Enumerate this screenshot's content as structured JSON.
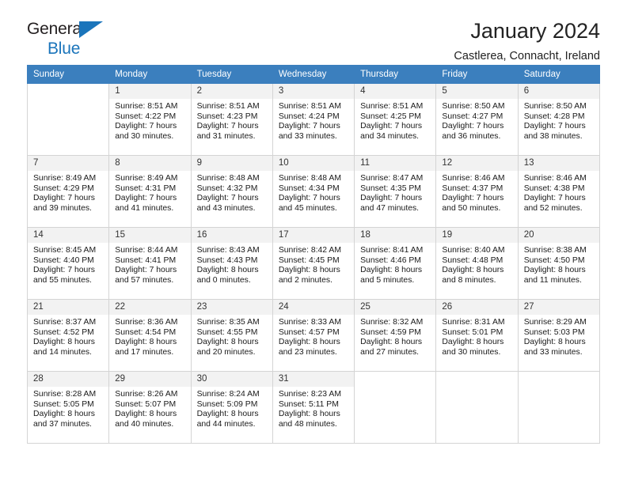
{
  "brand": {
    "line1": "General",
    "line2": "Blue",
    "triangle_color": "#1b75bb"
  },
  "header": {
    "title": "January 2024",
    "subtitle": "Castlerea, Connacht, Ireland"
  },
  "theme": {
    "header_row_bg": "#3b7fbe",
    "daynum_bg": "#f2f2f2",
    "grid_border": "#d4d4d4"
  },
  "labels": {
    "sunrise_prefix": "Sunrise:",
    "sunset_prefix": "Sunset:",
    "daylight_prefix": "Daylight:"
  },
  "weekdays": [
    "Sunday",
    "Monday",
    "Tuesday",
    "Wednesday",
    "Thursday",
    "Friday",
    "Saturday"
  ],
  "weeks": [
    [
      {
        "empty": true
      },
      {
        "day": "1",
        "sunrise": "Sunrise: 8:51 AM",
        "sunset": "Sunset: 4:22 PM",
        "daylight_l1": "Daylight: 7 hours",
        "daylight_l2": "and 30 minutes."
      },
      {
        "day": "2",
        "sunrise": "Sunrise: 8:51 AM",
        "sunset": "Sunset: 4:23 PM",
        "daylight_l1": "Daylight: 7 hours",
        "daylight_l2": "and 31 minutes."
      },
      {
        "day": "3",
        "sunrise": "Sunrise: 8:51 AM",
        "sunset": "Sunset: 4:24 PM",
        "daylight_l1": "Daylight: 7 hours",
        "daylight_l2": "and 33 minutes."
      },
      {
        "day": "4",
        "sunrise": "Sunrise: 8:51 AM",
        "sunset": "Sunset: 4:25 PM",
        "daylight_l1": "Daylight: 7 hours",
        "daylight_l2": "and 34 minutes."
      },
      {
        "day": "5",
        "sunrise": "Sunrise: 8:50 AM",
        "sunset": "Sunset: 4:27 PM",
        "daylight_l1": "Daylight: 7 hours",
        "daylight_l2": "and 36 minutes."
      },
      {
        "day": "6",
        "sunrise": "Sunrise: 8:50 AM",
        "sunset": "Sunset: 4:28 PM",
        "daylight_l1": "Daylight: 7 hours",
        "daylight_l2": "and 38 minutes."
      }
    ],
    [
      {
        "day": "7",
        "sunrise": "Sunrise: 8:49 AM",
        "sunset": "Sunset: 4:29 PM",
        "daylight_l1": "Daylight: 7 hours",
        "daylight_l2": "and 39 minutes."
      },
      {
        "day": "8",
        "sunrise": "Sunrise: 8:49 AM",
        "sunset": "Sunset: 4:31 PM",
        "daylight_l1": "Daylight: 7 hours",
        "daylight_l2": "and 41 minutes."
      },
      {
        "day": "9",
        "sunrise": "Sunrise: 8:48 AM",
        "sunset": "Sunset: 4:32 PM",
        "daylight_l1": "Daylight: 7 hours",
        "daylight_l2": "and 43 minutes."
      },
      {
        "day": "10",
        "sunrise": "Sunrise: 8:48 AM",
        "sunset": "Sunset: 4:34 PM",
        "daylight_l1": "Daylight: 7 hours",
        "daylight_l2": "and 45 minutes."
      },
      {
        "day": "11",
        "sunrise": "Sunrise: 8:47 AM",
        "sunset": "Sunset: 4:35 PM",
        "daylight_l1": "Daylight: 7 hours",
        "daylight_l2": "and 47 minutes."
      },
      {
        "day": "12",
        "sunrise": "Sunrise: 8:46 AM",
        "sunset": "Sunset: 4:37 PM",
        "daylight_l1": "Daylight: 7 hours",
        "daylight_l2": "and 50 minutes."
      },
      {
        "day": "13",
        "sunrise": "Sunrise: 8:46 AM",
        "sunset": "Sunset: 4:38 PM",
        "daylight_l1": "Daylight: 7 hours",
        "daylight_l2": "and 52 minutes."
      }
    ],
    [
      {
        "day": "14",
        "sunrise": "Sunrise: 8:45 AM",
        "sunset": "Sunset: 4:40 PM",
        "daylight_l1": "Daylight: 7 hours",
        "daylight_l2": "and 55 minutes."
      },
      {
        "day": "15",
        "sunrise": "Sunrise: 8:44 AM",
        "sunset": "Sunset: 4:41 PM",
        "daylight_l1": "Daylight: 7 hours",
        "daylight_l2": "and 57 minutes."
      },
      {
        "day": "16",
        "sunrise": "Sunrise: 8:43 AM",
        "sunset": "Sunset: 4:43 PM",
        "daylight_l1": "Daylight: 8 hours",
        "daylight_l2": "and 0 minutes."
      },
      {
        "day": "17",
        "sunrise": "Sunrise: 8:42 AM",
        "sunset": "Sunset: 4:45 PM",
        "daylight_l1": "Daylight: 8 hours",
        "daylight_l2": "and 2 minutes."
      },
      {
        "day": "18",
        "sunrise": "Sunrise: 8:41 AM",
        "sunset": "Sunset: 4:46 PM",
        "daylight_l1": "Daylight: 8 hours",
        "daylight_l2": "and 5 minutes."
      },
      {
        "day": "19",
        "sunrise": "Sunrise: 8:40 AM",
        "sunset": "Sunset: 4:48 PM",
        "daylight_l1": "Daylight: 8 hours",
        "daylight_l2": "and 8 minutes."
      },
      {
        "day": "20",
        "sunrise": "Sunrise: 8:38 AM",
        "sunset": "Sunset: 4:50 PM",
        "daylight_l1": "Daylight: 8 hours",
        "daylight_l2": "and 11 minutes."
      }
    ],
    [
      {
        "day": "21",
        "sunrise": "Sunrise: 8:37 AM",
        "sunset": "Sunset: 4:52 PM",
        "daylight_l1": "Daylight: 8 hours",
        "daylight_l2": "and 14 minutes."
      },
      {
        "day": "22",
        "sunrise": "Sunrise: 8:36 AM",
        "sunset": "Sunset: 4:54 PM",
        "daylight_l1": "Daylight: 8 hours",
        "daylight_l2": "and 17 minutes."
      },
      {
        "day": "23",
        "sunrise": "Sunrise: 8:35 AM",
        "sunset": "Sunset: 4:55 PM",
        "daylight_l1": "Daylight: 8 hours",
        "daylight_l2": "and 20 minutes."
      },
      {
        "day": "24",
        "sunrise": "Sunrise: 8:33 AM",
        "sunset": "Sunset: 4:57 PM",
        "daylight_l1": "Daylight: 8 hours",
        "daylight_l2": "and 23 minutes."
      },
      {
        "day": "25",
        "sunrise": "Sunrise: 8:32 AM",
        "sunset": "Sunset: 4:59 PM",
        "daylight_l1": "Daylight: 8 hours",
        "daylight_l2": "and 27 minutes."
      },
      {
        "day": "26",
        "sunrise": "Sunrise: 8:31 AM",
        "sunset": "Sunset: 5:01 PM",
        "daylight_l1": "Daylight: 8 hours",
        "daylight_l2": "and 30 minutes."
      },
      {
        "day": "27",
        "sunrise": "Sunrise: 8:29 AM",
        "sunset": "Sunset: 5:03 PM",
        "daylight_l1": "Daylight: 8 hours",
        "daylight_l2": "and 33 minutes."
      }
    ],
    [
      {
        "day": "28",
        "sunrise": "Sunrise: 8:28 AM",
        "sunset": "Sunset: 5:05 PM",
        "daylight_l1": "Daylight: 8 hours",
        "daylight_l2": "and 37 minutes."
      },
      {
        "day": "29",
        "sunrise": "Sunrise: 8:26 AM",
        "sunset": "Sunset: 5:07 PM",
        "daylight_l1": "Daylight: 8 hours",
        "daylight_l2": "and 40 minutes."
      },
      {
        "day": "30",
        "sunrise": "Sunrise: 8:24 AM",
        "sunset": "Sunset: 5:09 PM",
        "daylight_l1": "Daylight: 8 hours",
        "daylight_l2": "and 44 minutes."
      },
      {
        "day": "31",
        "sunrise": "Sunrise: 8:23 AM",
        "sunset": "Sunset: 5:11 PM",
        "daylight_l1": "Daylight: 8 hours",
        "daylight_l2": "and 48 minutes."
      },
      {
        "empty": true
      },
      {
        "empty": true
      },
      {
        "empty": true
      }
    ]
  ]
}
